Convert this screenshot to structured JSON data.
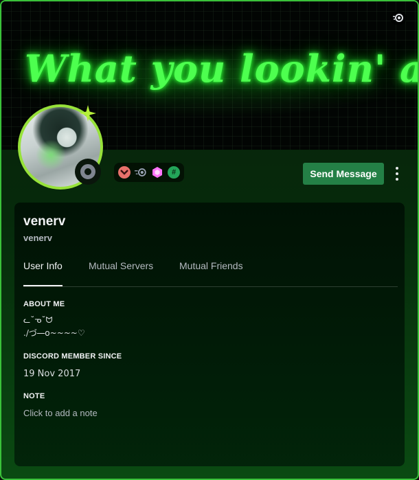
{
  "banner": {
    "neon_text": "What you lookin' at?",
    "nitro_icon": "nitro-badge-icon"
  },
  "profile": {
    "display_name": "venerv",
    "username": "venerv",
    "status": "offline",
    "ring_color": "#97e23a"
  },
  "badges": [
    {
      "icon": "hypesquad-brilliance-icon",
      "color": "#e8716b"
    },
    {
      "icon": "nitro-icon",
      "color": "#9aa3b5"
    },
    {
      "icon": "server-booster-icon",
      "color": "#ff73fa"
    },
    {
      "icon": "hashtag-icon",
      "color": "#23a559"
    }
  ],
  "actions": {
    "send_message": "Send Message",
    "more_icon": "more-vertical-icon"
  },
  "tabs": [
    {
      "label": "User Info",
      "active": true
    },
    {
      "label": "Mutual Servers",
      "active": false
    },
    {
      "label": "Mutual Friends",
      "active": false
    }
  ],
  "about": {
    "title": "ABOUT ME",
    "line1": "ᓚ˘ᓀ˘ᗢ",
    "line2": "./づ  ̶ ̶o~~~~♡"
  },
  "member_since": {
    "title": "DISCORD MEMBER SINCE",
    "value": "19 Nov 2017"
  },
  "note": {
    "title": "NOTE",
    "placeholder": "Click to add a note"
  },
  "colors": {
    "accent": "#248046",
    "neon": "#4dff4f",
    "border": "#3ac23a"
  }
}
